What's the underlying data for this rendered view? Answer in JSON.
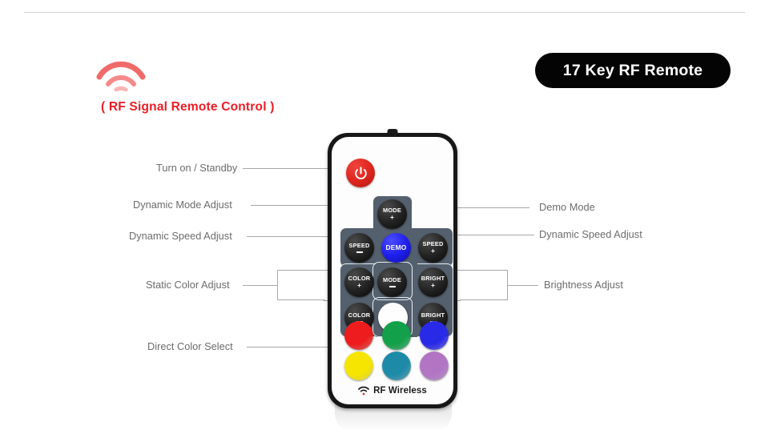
{
  "header": {
    "rule_visible": true,
    "title_badge": "17 Key RF Remote",
    "badge_bg": "#040404",
    "badge_text_color": "#ffffff"
  },
  "emblem": {
    "icon": "wifi-signal-icon",
    "color": "#f26d6d",
    "caption": "( RF Signal Remote Control )",
    "caption_color": "#ee1c24"
  },
  "device": {
    "name": "17-key-rf-remote",
    "body_color": "#171717",
    "face_color": "#fdfdfd",
    "keypad_plate_color": "#54606e",
    "footer": {
      "icon": "wifi-small-icon",
      "label": "RF Wireless"
    },
    "keys": {
      "power": {
        "icon": "power-icon",
        "color": "#e02820"
      },
      "mode_plus": {
        "label": "MODE",
        "sign": "+"
      },
      "speed_minus": {
        "label": "SPEED",
        "sign": "−"
      },
      "demo": {
        "label": "DEMO",
        "sign": "",
        "color": "#2020ee"
      },
      "speed_plus": {
        "label": "SPEED",
        "sign": "+"
      },
      "color_plus": {
        "label": "COLOR",
        "sign": "+"
      },
      "mode_minus": {
        "label": "MODE",
        "sign": "−"
      },
      "bright_plus": {
        "label": "BRIGHT",
        "sign": "+"
      },
      "color_minus": {
        "label": "COLOR",
        "sign": "−"
      },
      "white": {
        "label": "",
        "sign": "",
        "color": "#ffffff"
      },
      "bright_minus": {
        "label": "BRIGHT",
        "sign": "−"
      }
    },
    "color_keys": [
      {
        "name": "red",
        "color": "#ee1c1c"
      },
      {
        "name": "green",
        "color": "#13a04b"
      },
      {
        "name": "blue",
        "color": "#2929e8"
      },
      {
        "name": "yellow",
        "color": "#f5e500"
      },
      {
        "name": "cyan",
        "color": "#1d8aa8"
      },
      {
        "name": "purple",
        "color": "#b175c4"
      }
    ]
  },
  "callouts": {
    "left": [
      {
        "text": "Turn on / Standby",
        "target": "power-button"
      },
      {
        "text": "Dynamic Mode Adjust",
        "target": "mode-plus-key"
      },
      {
        "text": "Dynamic Speed Adjust",
        "target": "speed-minus-key"
      },
      {
        "text": "Static Color Adjust",
        "target": "color-keys-bracket"
      },
      {
        "text": "Direct Color Select",
        "target": "color-grid"
      }
    ],
    "right": [
      {
        "text": "Demo Mode",
        "target": "demo-key"
      },
      {
        "text": "Dynamic Speed Adjust",
        "target": "speed-plus-key"
      },
      {
        "text": "Brightness Adjust",
        "target": "bright-keys-bracket"
      }
    ],
    "line_color": "#a8a8a8",
    "text_color": "#6c6c6c"
  }
}
